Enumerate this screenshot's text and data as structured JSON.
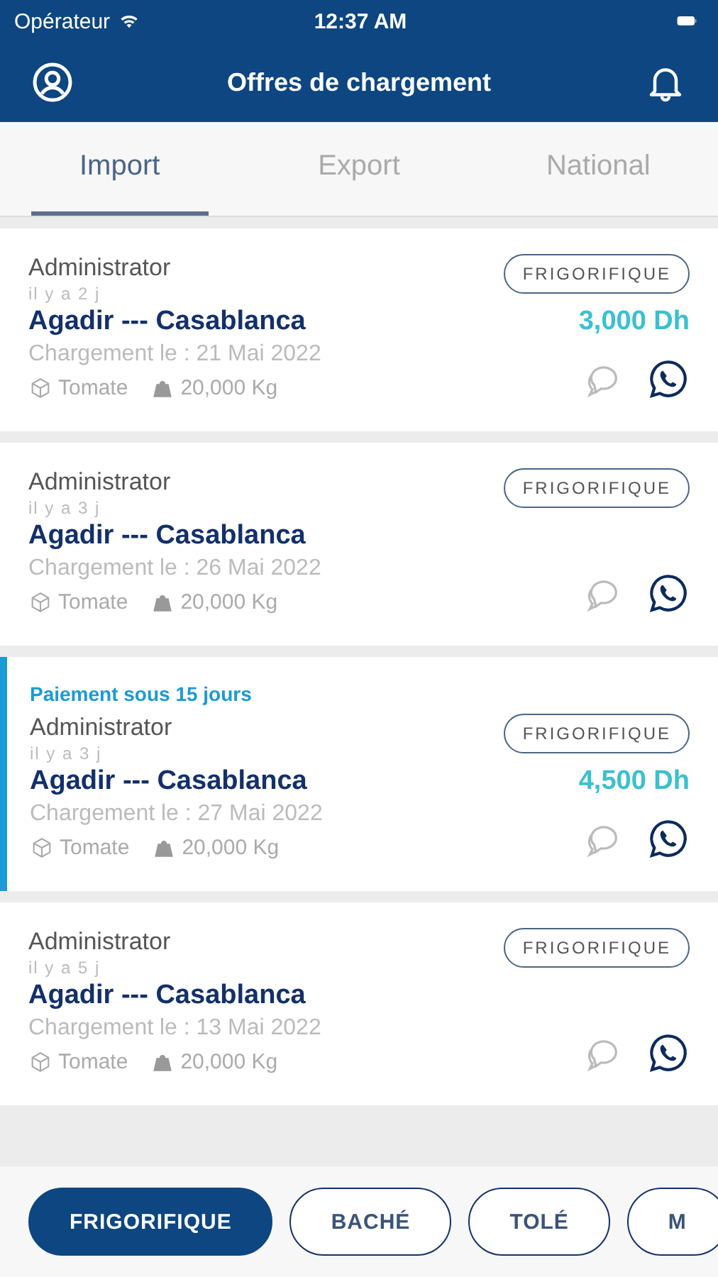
{
  "status_bar": {
    "carrier": "Opérateur",
    "time": "12:37 AM"
  },
  "header": {
    "title": "Offres de chargement"
  },
  "tabs": [
    {
      "label": "Import",
      "selected": true
    },
    {
      "label": "Export",
      "selected": false
    },
    {
      "label": "National",
      "selected": false
    }
  ],
  "offers": [
    {
      "highlighted": false,
      "author": "Administrator",
      "age": "il y a 2 j",
      "tag": "FRIGORIFIQUE",
      "route": "Agadir --- Casablanca",
      "price": "3,000 Dh",
      "date": "Chargement le : 21 Mai 2022",
      "goods": "Tomate",
      "weight": "20,000 Kg"
    },
    {
      "highlighted": false,
      "author": "Administrator",
      "age": "il y a 3 j",
      "tag": "FRIGORIFIQUE",
      "route": "Agadir --- Casablanca",
      "date": "Chargement le : 26 Mai 2022",
      "goods": "Tomate",
      "weight": "20,000 Kg"
    },
    {
      "highlighted": true,
      "note": "Paiement sous 15 jours",
      "author": "Administrator",
      "age": "il y a 3 j",
      "tag": "FRIGORIFIQUE",
      "route": "Agadir --- Casablanca",
      "price": "4,500 Dh",
      "date": "Chargement le : 27 Mai 2022",
      "goods": "Tomate",
      "weight": "20,000 Kg"
    },
    {
      "highlighted": false,
      "author": "Administrator",
      "age": "il y a 5 j",
      "tag": "FRIGORIFIQUE",
      "route": "Agadir --- Casablanca",
      "date": "Chargement le : 13 Mai 2022",
      "goods": "Tomate",
      "weight": "20,000 Kg"
    }
  ],
  "filters": [
    {
      "label": "FRIGORIFIQUE",
      "selected": true
    },
    {
      "label": "BACHÉ",
      "selected": false
    },
    {
      "label": "TOLÉ",
      "selected": false
    },
    {
      "label": "M",
      "selected": false
    }
  ]
}
